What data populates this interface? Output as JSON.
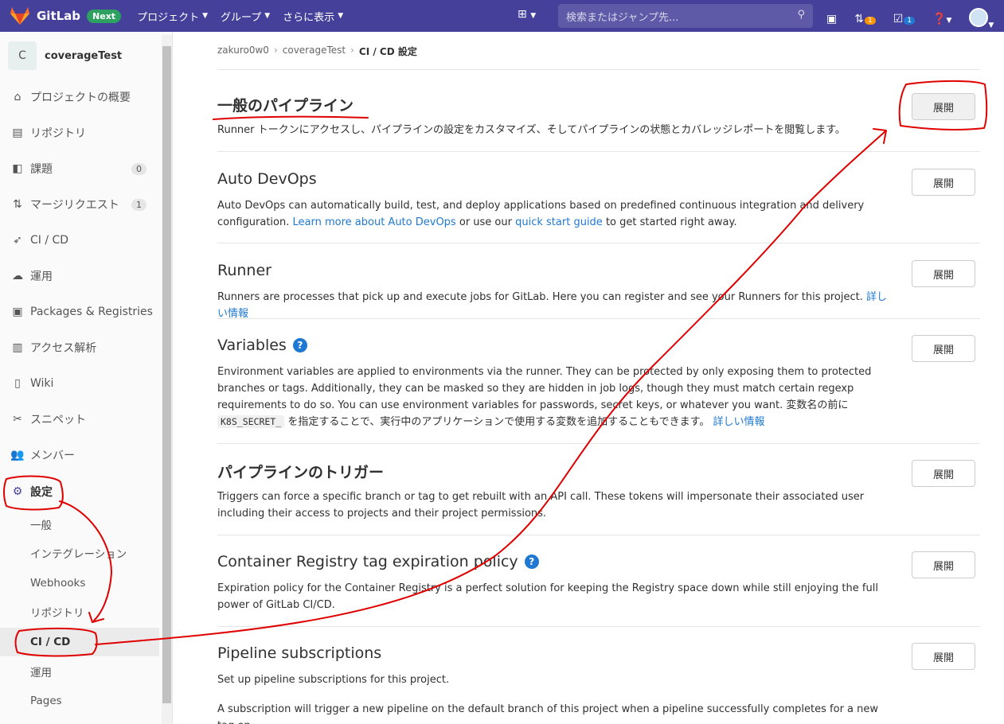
{
  "navbar": {
    "brand": "GitLab",
    "badge": "Next",
    "menu": [
      "プロジェクト",
      "グループ",
      "さらに表示"
    ],
    "search_placeholder": "検索またはジャンプ先...",
    "merge_count": "1",
    "todo_count": "1"
  },
  "sidebar": {
    "project_initial": "C",
    "project_name": "coverageTest",
    "items": [
      {
        "label": "プロジェクトの概要",
        "icon": "home-icon"
      },
      {
        "label": "リポジトリ",
        "icon": "document-icon"
      },
      {
        "label": "課題",
        "icon": "issues-icon",
        "badge": "0"
      },
      {
        "label": "マージリクエスト",
        "icon": "merge-request-icon",
        "badge": "1"
      },
      {
        "label": "CI / CD",
        "icon": "rocket-icon"
      },
      {
        "label": "運用",
        "icon": "cloud-icon"
      },
      {
        "label": "Packages & Registries",
        "icon": "package-icon"
      },
      {
        "label": "アクセス解析",
        "icon": "chart-icon"
      },
      {
        "label": "Wiki",
        "icon": "book-icon"
      },
      {
        "label": "スニペット",
        "icon": "scissors-icon"
      },
      {
        "label": "メンバー",
        "icon": "users-icon"
      },
      {
        "label": "設定",
        "icon": "gear-icon"
      }
    ],
    "sub_items": [
      "一般",
      "インテグレーション",
      "Webhooks",
      "リポジトリ",
      "CI / CD",
      "運用",
      "Pages"
    ]
  },
  "breadcrumb": [
    "zakuro0w0",
    "coverageTest",
    "CI / CD 設定"
  ],
  "expand_label": "展開",
  "sections": {
    "general": {
      "title": "一般のパイプライン",
      "desc": "Runner トークンにアクセスし、パイプラインの設定をカスタマイズ、そしてパイプラインの状態とカバレッジレポートを閲覧します。"
    },
    "autodevops": {
      "title": "Auto DevOps",
      "desc1": "Auto DevOps can automatically build, test, and deploy applications based on predefined continuous integration and delivery configuration.",
      "link1": "Learn more about Auto DevOps",
      "mid": "or use our",
      "link2": "quick start guide",
      "end": "to get started right away."
    },
    "runner": {
      "title": "Runner",
      "desc": "Runners are processes that pick up and execute jobs for GitLab. Here you can register and see your Runners for this project.",
      "link": "詳しい情報"
    },
    "variables": {
      "title": "Variables",
      "desc1": "Environment variables are applied to environments via the runner. They can be protected by only exposing them to protected branches or tags. Additionally, they can be masked so they are hidden in job logs, though they must match certain regexp requirements to do so. You can use environment variables for passwords, secret keys, or whatever you want. 変数名の前に",
      "code": "K8S_SECRET_",
      "desc2": "を指定することで、実行中のアプリケーションで使用する変数を追加することもできます。",
      "link": "詳しい情報"
    },
    "triggers": {
      "title": "パイプラインのトリガー",
      "desc": "Triggers can force a specific branch or tag to get rebuilt with an API call. These tokens will impersonate their associated user including their access to projects and their project permissions."
    },
    "registry": {
      "title": "Container Registry tag expiration policy",
      "desc": "Expiration policy for the Container Registry is a perfect solution for keeping the Registry space down while still enjoying the full power of GitLab CI/CD."
    },
    "subscriptions": {
      "title": "Pipeline subscriptions",
      "desc": "Set up pipeline subscriptions for this project.",
      "desc2": "A subscription will trigger a new pipeline on the default branch of this project when a pipeline successfully completes for a new tag on"
    }
  },
  "colors": {
    "navbar": "#45419b",
    "link": "#1f78d1",
    "annotation": "#e00000"
  }
}
